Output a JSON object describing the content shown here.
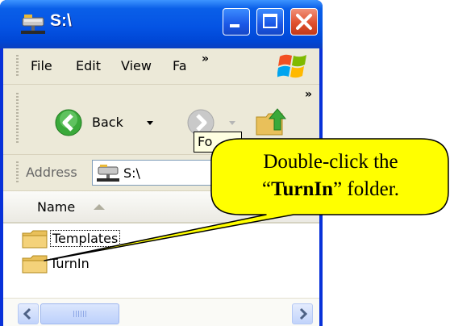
{
  "window": {
    "title": "S:\\",
    "colors": {
      "titlebar": "#0554e4",
      "frame": "#0831d9",
      "client": "#ece9d8",
      "close_button": "#e0502e"
    }
  },
  "menubar": {
    "items": [
      "File",
      "Edit",
      "View",
      "Fa"
    ],
    "overflow_chevron": "»"
  },
  "toolbar": {
    "back_label": "Back",
    "overflow_chevron": "»",
    "tooltip_text": "Fo"
  },
  "addressbar": {
    "label": "Address",
    "value": "S:\\"
  },
  "filelist": {
    "column_header": "Name",
    "items": [
      {
        "name": "Templates",
        "icon": "folder-icon"
      },
      {
        "name": "TurnIn",
        "icon": "folder-icon"
      }
    ],
    "scrollbar_thumb_fraction": 0.3
  },
  "callout": {
    "line1": "Double-click the",
    "open_quote": "“",
    "highlight": "TurnIn",
    "close_quote": "”",
    "tail": " folder.",
    "fill": "#ffff00"
  }
}
